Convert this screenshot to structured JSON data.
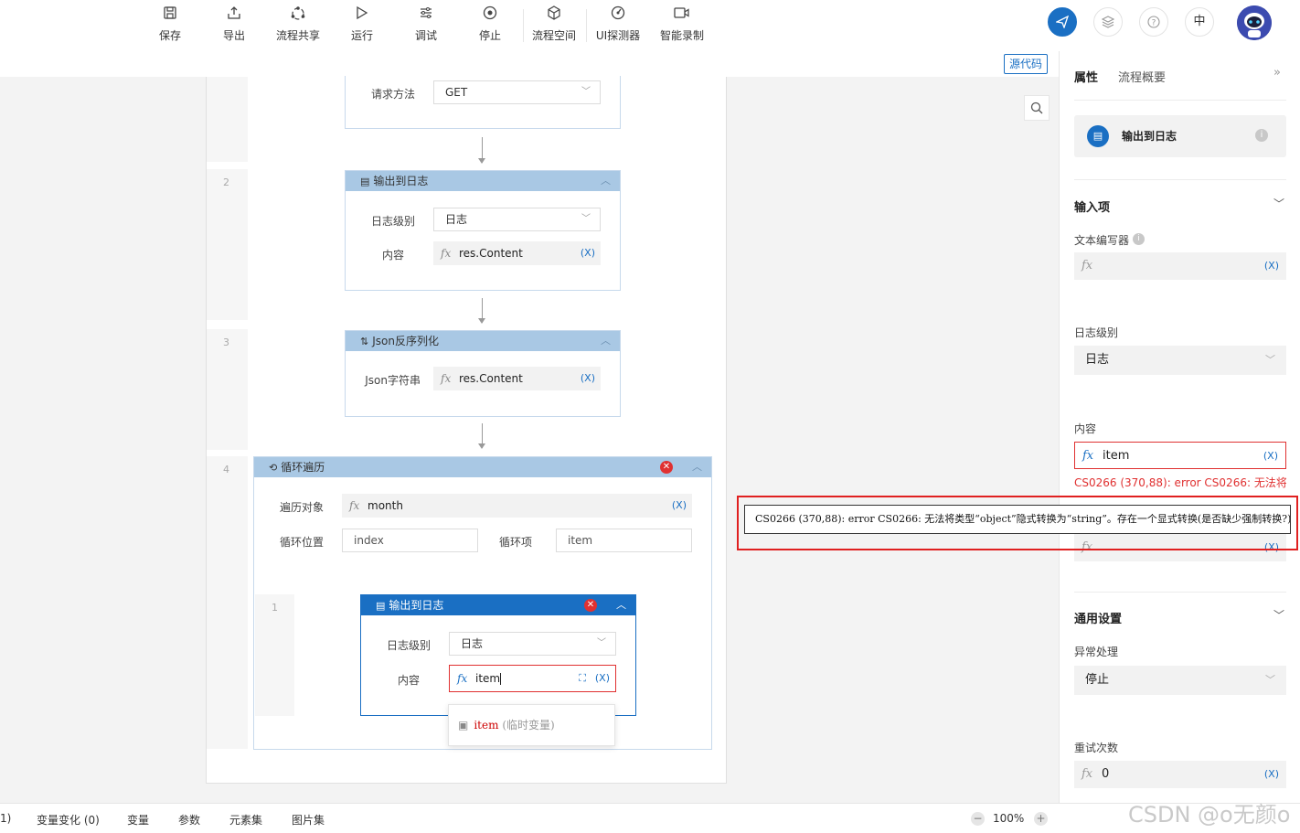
{
  "toolbar": {
    "buttons": [
      {
        "label": "保存",
        "icon": "save-icon"
      },
      {
        "label": "导出",
        "icon": "export-icon"
      },
      {
        "label": "流程共享",
        "icon": "share-icon"
      },
      {
        "label": "运行",
        "icon": "run-icon"
      },
      {
        "label": "调试",
        "icon": "debug-icon"
      },
      {
        "label": "停止",
        "icon": "stop-icon"
      },
      {
        "label": "流程空间",
        "icon": "cube-icon"
      },
      {
        "label": "UI探测器",
        "icon": "ui-detector-icon"
      },
      {
        "label": "智能录制",
        "icon": "record-icon"
      }
    ],
    "lang_label": "中",
    "source_code_label": "源代码"
  },
  "flow": {
    "step1": {
      "method_label": "请求方法",
      "method_value": "GET"
    },
    "step2": {
      "num": "2",
      "title": "输出到日志",
      "level_label": "日志级别",
      "level_value": "日志",
      "content_label": "内容",
      "content_value": "res.Content"
    },
    "step3": {
      "num": "3",
      "title": "Json反序列化",
      "json_label": "Json字符串",
      "json_value": "res.Content"
    },
    "step4": {
      "num": "4",
      "title": "循环遍历",
      "target_label": "遍历对象",
      "target_value": "month",
      "pos_label": "循环位置",
      "pos_placeholder": "index",
      "item_label": "循环项",
      "item_placeholder": "item"
    },
    "inner": {
      "num": "1",
      "title": "输出到日志",
      "level_label": "日志级别",
      "level_value": "日志",
      "content_label": "内容",
      "content_value": "item"
    },
    "suggestion": {
      "name": "item",
      "type": "(临时变量)"
    }
  },
  "x_symbol": "(X)",
  "fx_symbol": "fx",
  "error_tooltip": "CS0266 (370,88): error CS0266: 无法将类型“object”隐式转换为“string”。存在一个显式转换(是否缺少强制转换?)",
  "panel": {
    "tab_props": "属性",
    "tab_overview": "流程概要",
    "node_title": "输出到日志",
    "section_inputs": "输入项",
    "text_editor_label": "文本编写器",
    "log_level_label": "日志级别",
    "log_level_value": "日志",
    "content_label": "内容",
    "content_value": "item",
    "content_error": "CS0266 (370,88): error CS0266: 无法将...",
    "section_general": "通用设置",
    "exception_label": "异常处理",
    "exception_value": "停止",
    "retry_label": "重试次数",
    "retry_value": "0"
  },
  "bottom": {
    "first_fragment": "1)",
    "tabs": [
      "变量变化 (0)",
      "变量",
      "参数",
      "元素集",
      "图片集"
    ],
    "zoom": "100%",
    "watermark": "CSDN @o无颜o"
  },
  "colors": {
    "accent": "#1a6fc3",
    "node_header": "#a9c8e4",
    "active_header": "#1a6fc3",
    "error": "#e03131"
  }
}
